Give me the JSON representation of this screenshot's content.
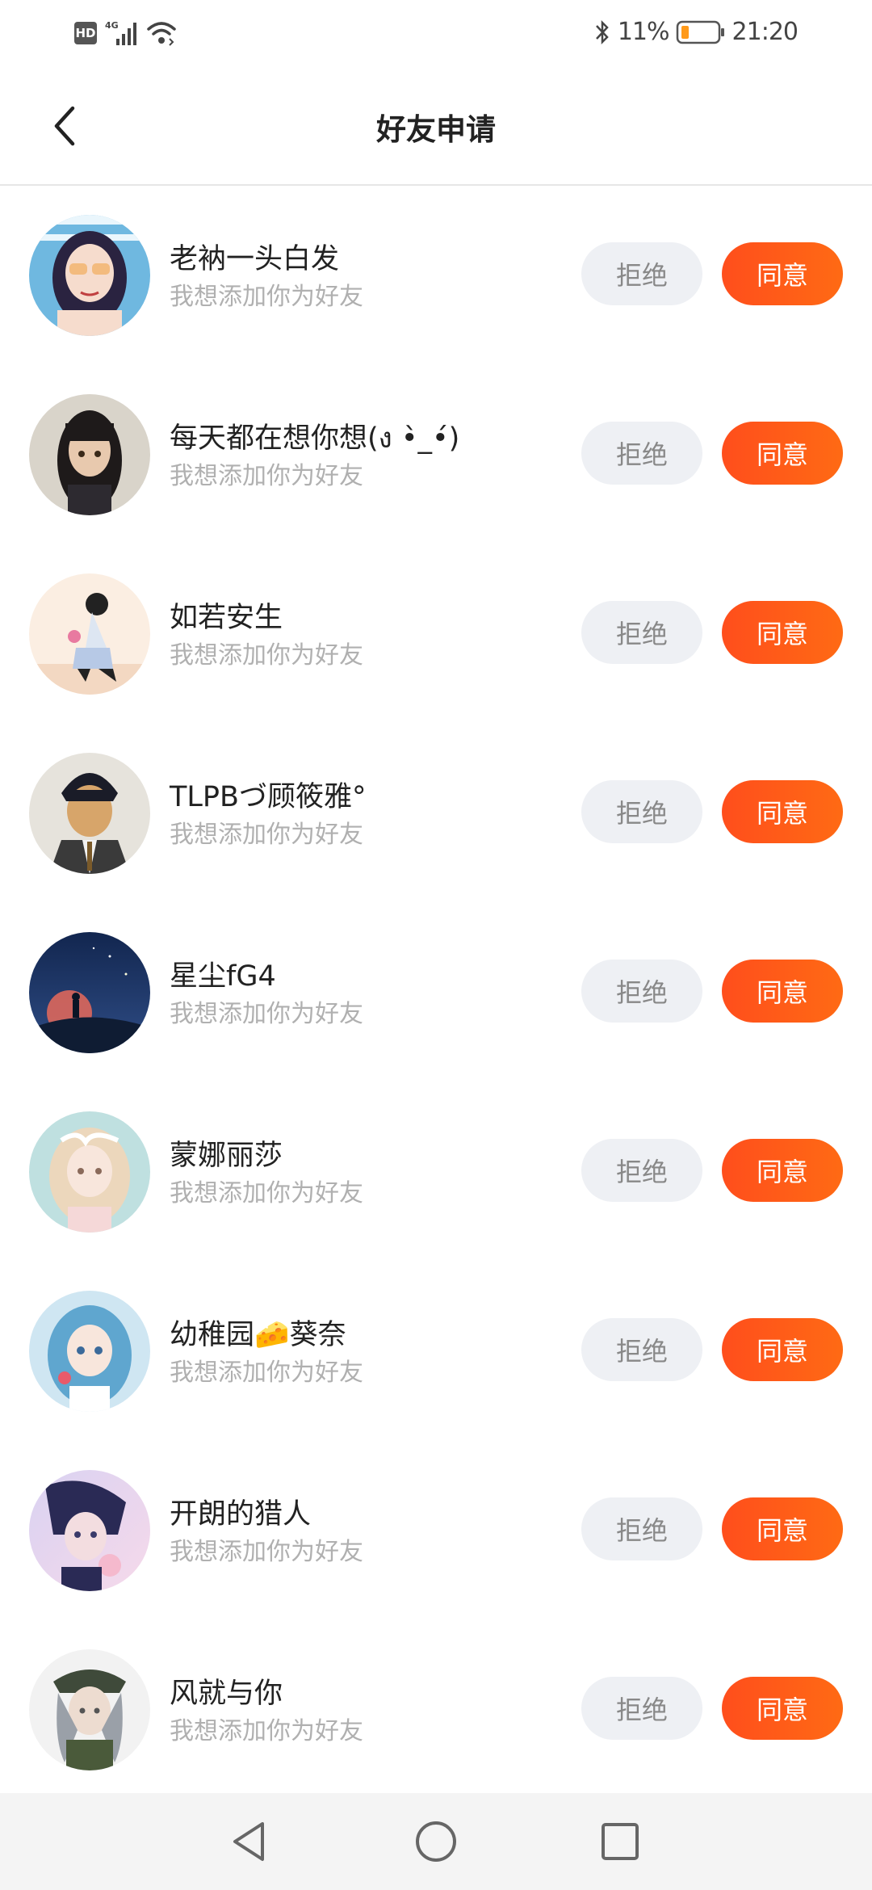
{
  "status_bar": {
    "hd_label": "HD",
    "network_label": "4G",
    "battery_percent": "11%",
    "time": "21:20",
    "icons": [
      "signal-icon",
      "wifi-icon",
      "bluetooth-icon",
      "battery-icon"
    ]
  },
  "header": {
    "title": "好友申请",
    "back_icon": "chevron-left-icon"
  },
  "requests": [
    {
      "name": "老衲一头白发",
      "message": "我想添加你为好友",
      "reject_label": "拒绝",
      "accept_label": "同意"
    },
    {
      "name": "每天都在想你想(ง •̀_•́)",
      "message": "我想添加你为好友",
      "reject_label": "拒绝",
      "accept_label": "同意"
    },
    {
      "name": "如若安生",
      "message": "我想添加你为好友",
      "reject_label": "拒绝",
      "accept_label": "同意"
    },
    {
      "name": "TLPBづ顾筱雅°",
      "message": "我想添加你为好友",
      "reject_label": "拒绝",
      "accept_label": "同意"
    },
    {
      "name": "星尘fG4",
      "message": "我想添加你为好友",
      "reject_label": "拒绝",
      "accept_label": "同意"
    },
    {
      "name": "蒙娜丽莎",
      "message": "我想添加你为好友",
      "reject_label": "拒绝",
      "accept_label": "同意"
    },
    {
      "name": "幼稚园🧀葵奈",
      "message": "我想添加你为好友",
      "reject_label": "拒绝",
      "accept_label": "同意"
    },
    {
      "name": "开朗的猎人",
      "message": "我想添加你为好友",
      "reject_label": "拒绝",
      "accept_label": "同意"
    },
    {
      "name": "风就与你",
      "message": "我想添加你为好友",
      "reject_label": "拒绝",
      "accept_label": "同意"
    }
  ],
  "colors": {
    "accent": "#ff5a1a",
    "reject_bg": "#eef0f4",
    "subtext": "#b0b0b0"
  },
  "nav_bar": {
    "icons": [
      "back-triangle-icon",
      "home-circle-icon",
      "recents-square-icon"
    ]
  }
}
